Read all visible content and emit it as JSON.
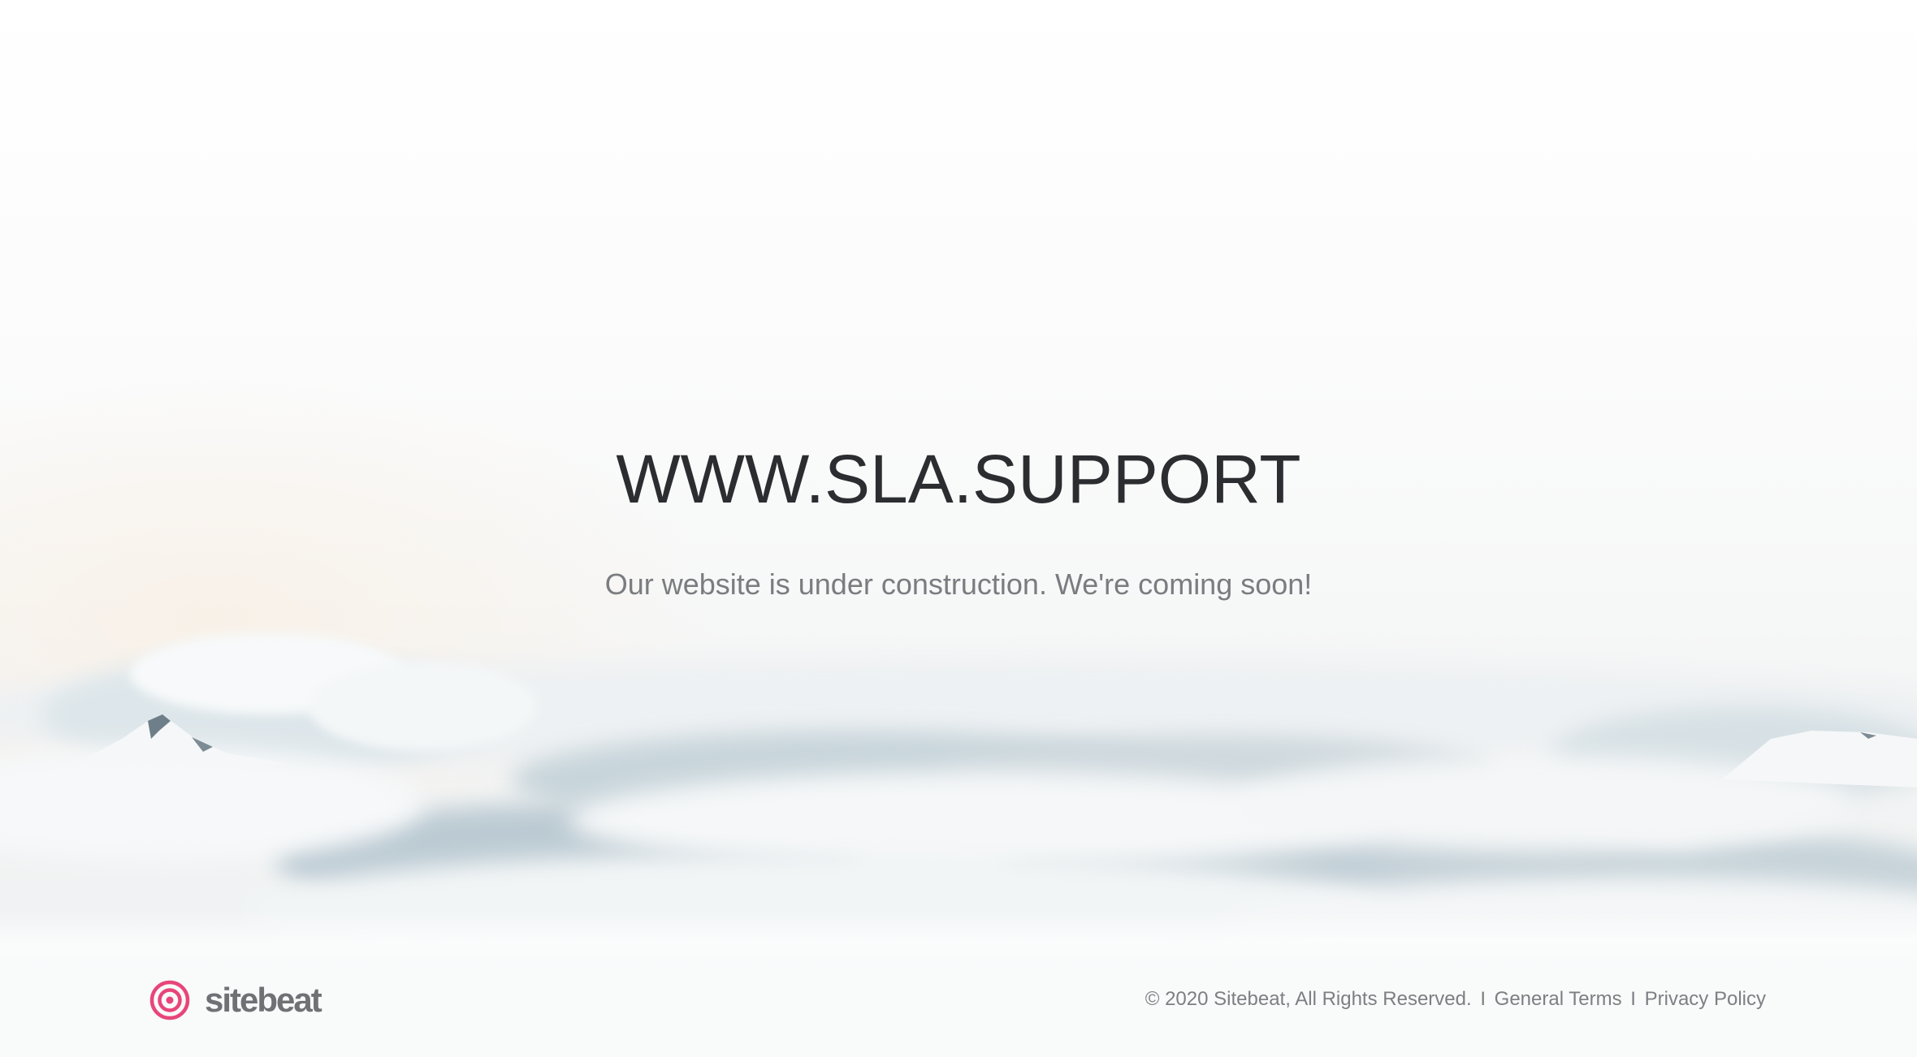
{
  "hero": {
    "title": "WWW.SLA.SUPPORT",
    "subtitle": "Our website is under construction. We're coming soon!"
  },
  "footer": {
    "brand": {
      "name": "sitebeat",
      "icon": "target-icon",
      "icon_color": "#e8457a"
    },
    "copyright": "© 2020 Sitebeat, All Rights Reserved.",
    "separator": "I",
    "links": [
      {
        "label": "General Terms"
      },
      {
        "label": "Privacy Policy"
      }
    ]
  },
  "background": {
    "scene": "clouds-mountains",
    "colors": {
      "sky": "#f7f8f8",
      "cloud_shadow": "#b9c8d0"
    }
  }
}
